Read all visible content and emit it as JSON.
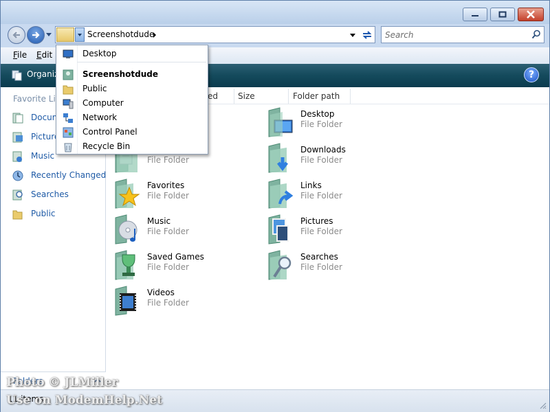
{
  "window": {
    "title": "",
    "caption_buttons": [
      "minimize-icon",
      "maximize-icon",
      "close-icon"
    ]
  },
  "nav": {
    "address": {
      "path_label": "Screenshotdude",
      "dropdown_arrow": "chevron-down-icon"
    },
    "search": {
      "placeholder": "Search"
    }
  },
  "menubar": {
    "items": [
      {
        "label": "File",
        "underline": "F",
        "rest": "ile"
      },
      {
        "label": "Edit",
        "underline": "E",
        "rest": "dit"
      }
    ]
  },
  "toolbar": {
    "organize_label": "Organiz",
    "help_label": "?"
  },
  "left_pane": {
    "header": "Favorite Lin",
    "items": [
      {
        "label": "Docum",
        "icon": "documents-icon"
      },
      {
        "label": "Picture",
        "icon": "pictures-icon"
      },
      {
        "label": "Music",
        "icon": "music-icon"
      },
      {
        "label": "Recently Changed",
        "icon": "recent-icon"
      },
      {
        "label": "Searches",
        "icon": "searches-icon"
      },
      {
        "label": "Public",
        "icon": "folder-icon"
      }
    ],
    "folders_label": "Folders"
  },
  "columns": {
    "headers": [
      "ed",
      "Size",
      "Folder path"
    ]
  },
  "files": [
    {
      "name": "",
      "type": "File Folder",
      "icon": "documents-folder-icon"
    },
    {
      "name": "Desktop",
      "type": "File Folder",
      "icon": "desktop-folder-icon"
    },
    {
      "name": "Downloads",
      "type": "File Folder",
      "icon": "downloads-folder-icon"
    },
    {
      "name": "Favorites",
      "type": "File Folder",
      "icon": "favorites-folder-icon"
    },
    {
      "name": "Links",
      "type": "File Folder",
      "icon": "links-folder-icon"
    },
    {
      "name": "Music",
      "type": "File Folder",
      "icon": "music-folder-icon"
    },
    {
      "name": "Pictures",
      "type": "File Folder",
      "icon": "pictures-folder-icon"
    },
    {
      "name": "Saved Games",
      "type": "File Folder",
      "icon": "saved-games-folder-icon"
    },
    {
      "name": "Searches",
      "type": "File Folder",
      "icon": "searches-folder-icon"
    },
    {
      "name": "Videos",
      "type": "File Folder",
      "icon": "videos-folder-icon"
    }
  ],
  "status": {
    "count": "11 items"
  },
  "address_dropdown": {
    "items": [
      {
        "label": "Desktop",
        "icon": "desktop-icon",
        "bold": false
      },
      {
        "label": "Screenshotdude",
        "icon": "user-folder-icon",
        "bold": true
      },
      {
        "label": "Public",
        "icon": "folder-icon",
        "bold": false
      },
      {
        "label": "Computer",
        "icon": "computer-icon",
        "bold": false
      },
      {
        "label": "Network",
        "icon": "network-icon",
        "bold": false
      },
      {
        "label": "Control Panel",
        "icon": "control-panel-icon",
        "bold": false
      },
      {
        "label": "Recycle Bin",
        "icon": "recycle-bin-icon",
        "bold": false
      }
    ]
  },
  "watermark": {
    "line1": "Photo © JLMiller",
    "line2": "Use on ModemHelp.Net"
  },
  "colors": {
    "link_blue": "#1e5aa6",
    "toolbar_teal": "#144a5c",
    "close_red": "#c4402a"
  }
}
